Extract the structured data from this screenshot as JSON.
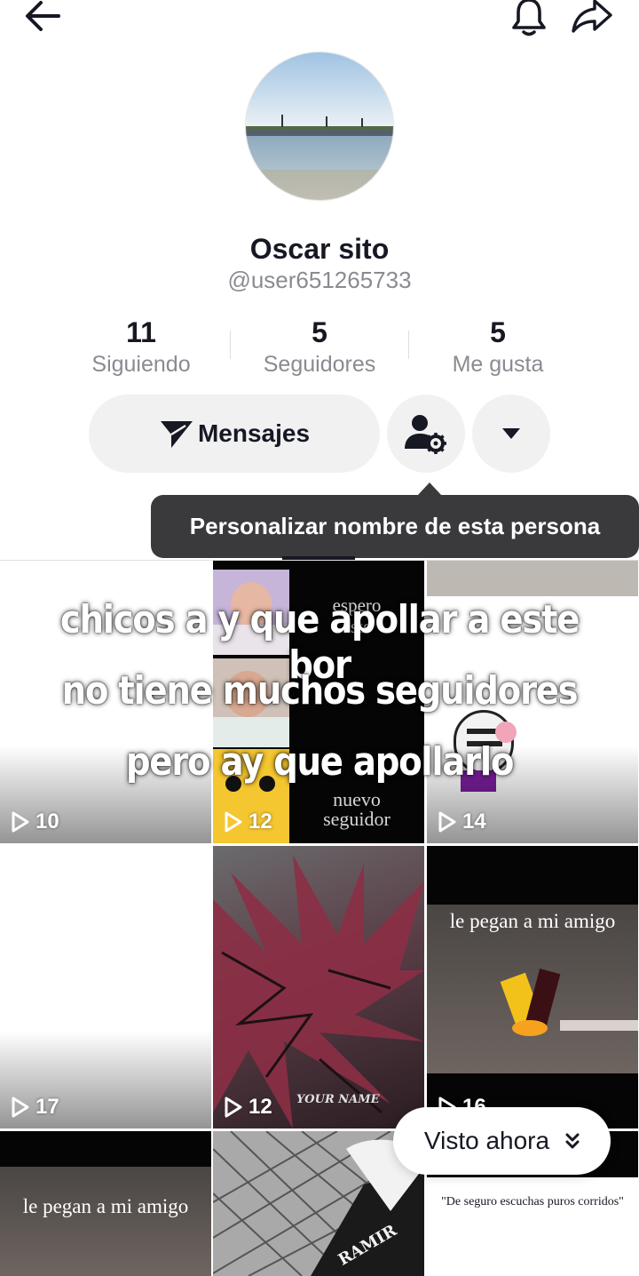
{
  "profile": {
    "name": "Oscar sito",
    "handle": "@user651265733"
  },
  "stats": [
    {
      "value": "11",
      "label": "Siguiendo"
    },
    {
      "value": "5",
      "label": "Seguidores"
    },
    {
      "value": "5",
      "label": "Me gusta"
    }
  ],
  "actions": {
    "message_label": "Mensajes"
  },
  "tooltip": {
    "text": "Personalizar nombre de esta persona"
  },
  "overlay": {
    "lines": [
      "chicos a y que apollar a este bor",
      "no tiene muchos seguidores",
      "pero ay que apollarlo"
    ]
  },
  "videos": [
    {
      "views": "10"
    },
    {
      "views": "12",
      "caption_top": "espero",
      "caption_top2": "este",
      "caption_bottom": "nuevo",
      "caption_bottom2": "seguidor"
    },
    {
      "views": "14"
    },
    {
      "views": "17"
    },
    {
      "views": "12",
      "watermark": "YOUR NAME"
    },
    {
      "views": "16",
      "caption": "le pegan a mi amigo"
    },
    {
      "caption": "le pegan a mi amigo"
    },
    {
      "caption": "RAMIR"
    },
    {
      "caption": "\"De seguro escuchas puros corridos\""
    }
  ],
  "visto_button": {
    "label": "Visto ahora"
  },
  "colors": {
    "text_primary": "#161823",
    "text_secondary": "#8a8b91",
    "button_bg": "#f1f1f2",
    "tooltip_bg": "#3a3a3c"
  }
}
